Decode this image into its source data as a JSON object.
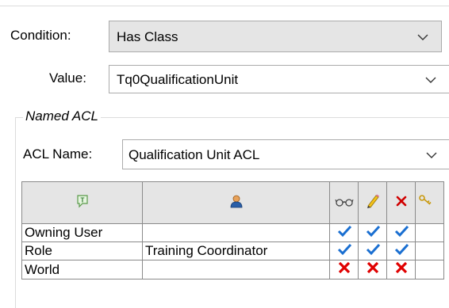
{
  "condition": {
    "label": "Condition:",
    "value": "Has Class"
  },
  "value_field": {
    "label": "Value:",
    "value": "Tq0QualificationUnit"
  },
  "named_acl": {
    "group_label": "Named ACL",
    "acl_name_label": "ACL Name:",
    "acl_name_value": "Qualification Unit ACL"
  },
  "acl_table": {
    "columns": [
      "accessor-type-icon",
      "accessor-icon",
      "read-icon",
      "write-icon",
      "delete-icon",
      "change-ownership-icon"
    ],
    "rows": [
      {
        "accessor_type": "Owning User",
        "accessor": "",
        "read": "check",
        "write": "check",
        "delete": "check"
      },
      {
        "accessor_type": "Role",
        "accessor": "Training Coordinator",
        "read": "check",
        "write": "check",
        "delete": "check"
      },
      {
        "accessor_type": "World",
        "accessor": "",
        "read": "deny",
        "write": "deny",
        "delete": "deny"
      }
    ]
  },
  "colors": {
    "check": "#1a6fd1",
    "deny": "#e00000",
    "combo_focus_bg": "#e5e5e5"
  }
}
